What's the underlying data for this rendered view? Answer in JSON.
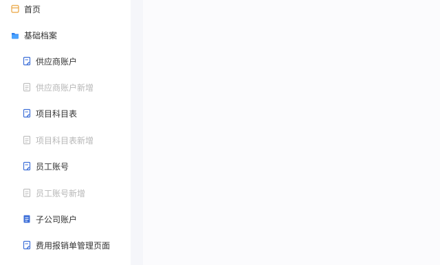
{
  "sidebar": {
    "items": [
      {
        "label": "首页",
        "icon": "home-icon",
        "state": "normal"
      },
      {
        "label": "基础档案",
        "icon": "folder-icon",
        "state": "normal"
      },
      {
        "label": "供应商账户",
        "icon": "document-edit-icon",
        "state": "normal"
      },
      {
        "label": "供应商账户新增",
        "icon": "document-icon",
        "state": "disabled"
      },
      {
        "label": "项目科目表",
        "icon": "document-edit-icon",
        "state": "normal"
      },
      {
        "label": "项目科目表新增",
        "icon": "document-icon",
        "state": "disabled"
      },
      {
        "label": "员工账号",
        "icon": "document-edit-icon",
        "state": "normal"
      },
      {
        "label": "员工账号新增",
        "icon": "document-icon",
        "state": "disabled"
      },
      {
        "label": "子公司账户",
        "icon": "document-list-icon",
        "state": "normal"
      },
      {
        "label": "费用报销单管理页面",
        "icon": "document-edit-icon",
        "state": "normal"
      }
    ]
  },
  "colors": {
    "icon_blue": "#3d6fd8",
    "icon_orange": "#e9a23b",
    "disabled_text": "#b7b7b7",
    "text": "#333333"
  }
}
